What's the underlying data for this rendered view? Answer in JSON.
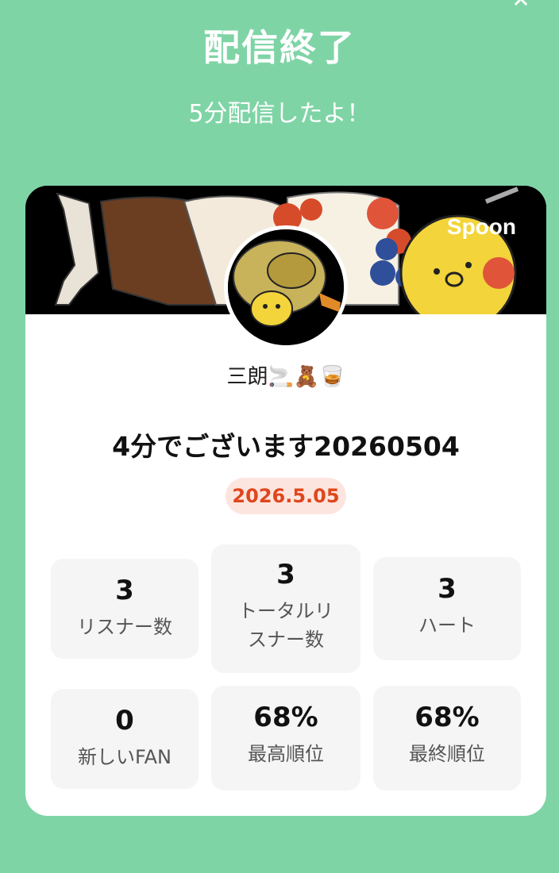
{
  "header": {
    "title": "配信終了",
    "subtitle": "5分配信したよ！",
    "close_symbol": "✕"
  },
  "card": {
    "brand": "Spoon",
    "username": "三朗🚬🧸🥃",
    "stream_title": "4分でございます20260504",
    "date": "2026.5.05"
  },
  "stats": [
    {
      "value": "3",
      "label_lines": [
        "リスナー数"
      ]
    },
    {
      "value": "3",
      "label_lines": [
        "トータルリ",
        "スナー数"
      ]
    },
    {
      "value": "3",
      "label_lines": [
        "ハート"
      ]
    },
    {
      "value": "0",
      "label_lines": [
        "新しいFAN"
      ]
    },
    {
      "value": "68%",
      "label_lines": [
        "最高順位"
      ]
    },
    {
      "value": "68%",
      "label_lines": [
        "最終順位"
      ]
    }
  ],
  "colors": {
    "background": "#7fd4a6",
    "date_badge_bg": "#fde5df",
    "date_badge_text": "#e0461c",
    "stat_bg": "#f5f5f5"
  }
}
